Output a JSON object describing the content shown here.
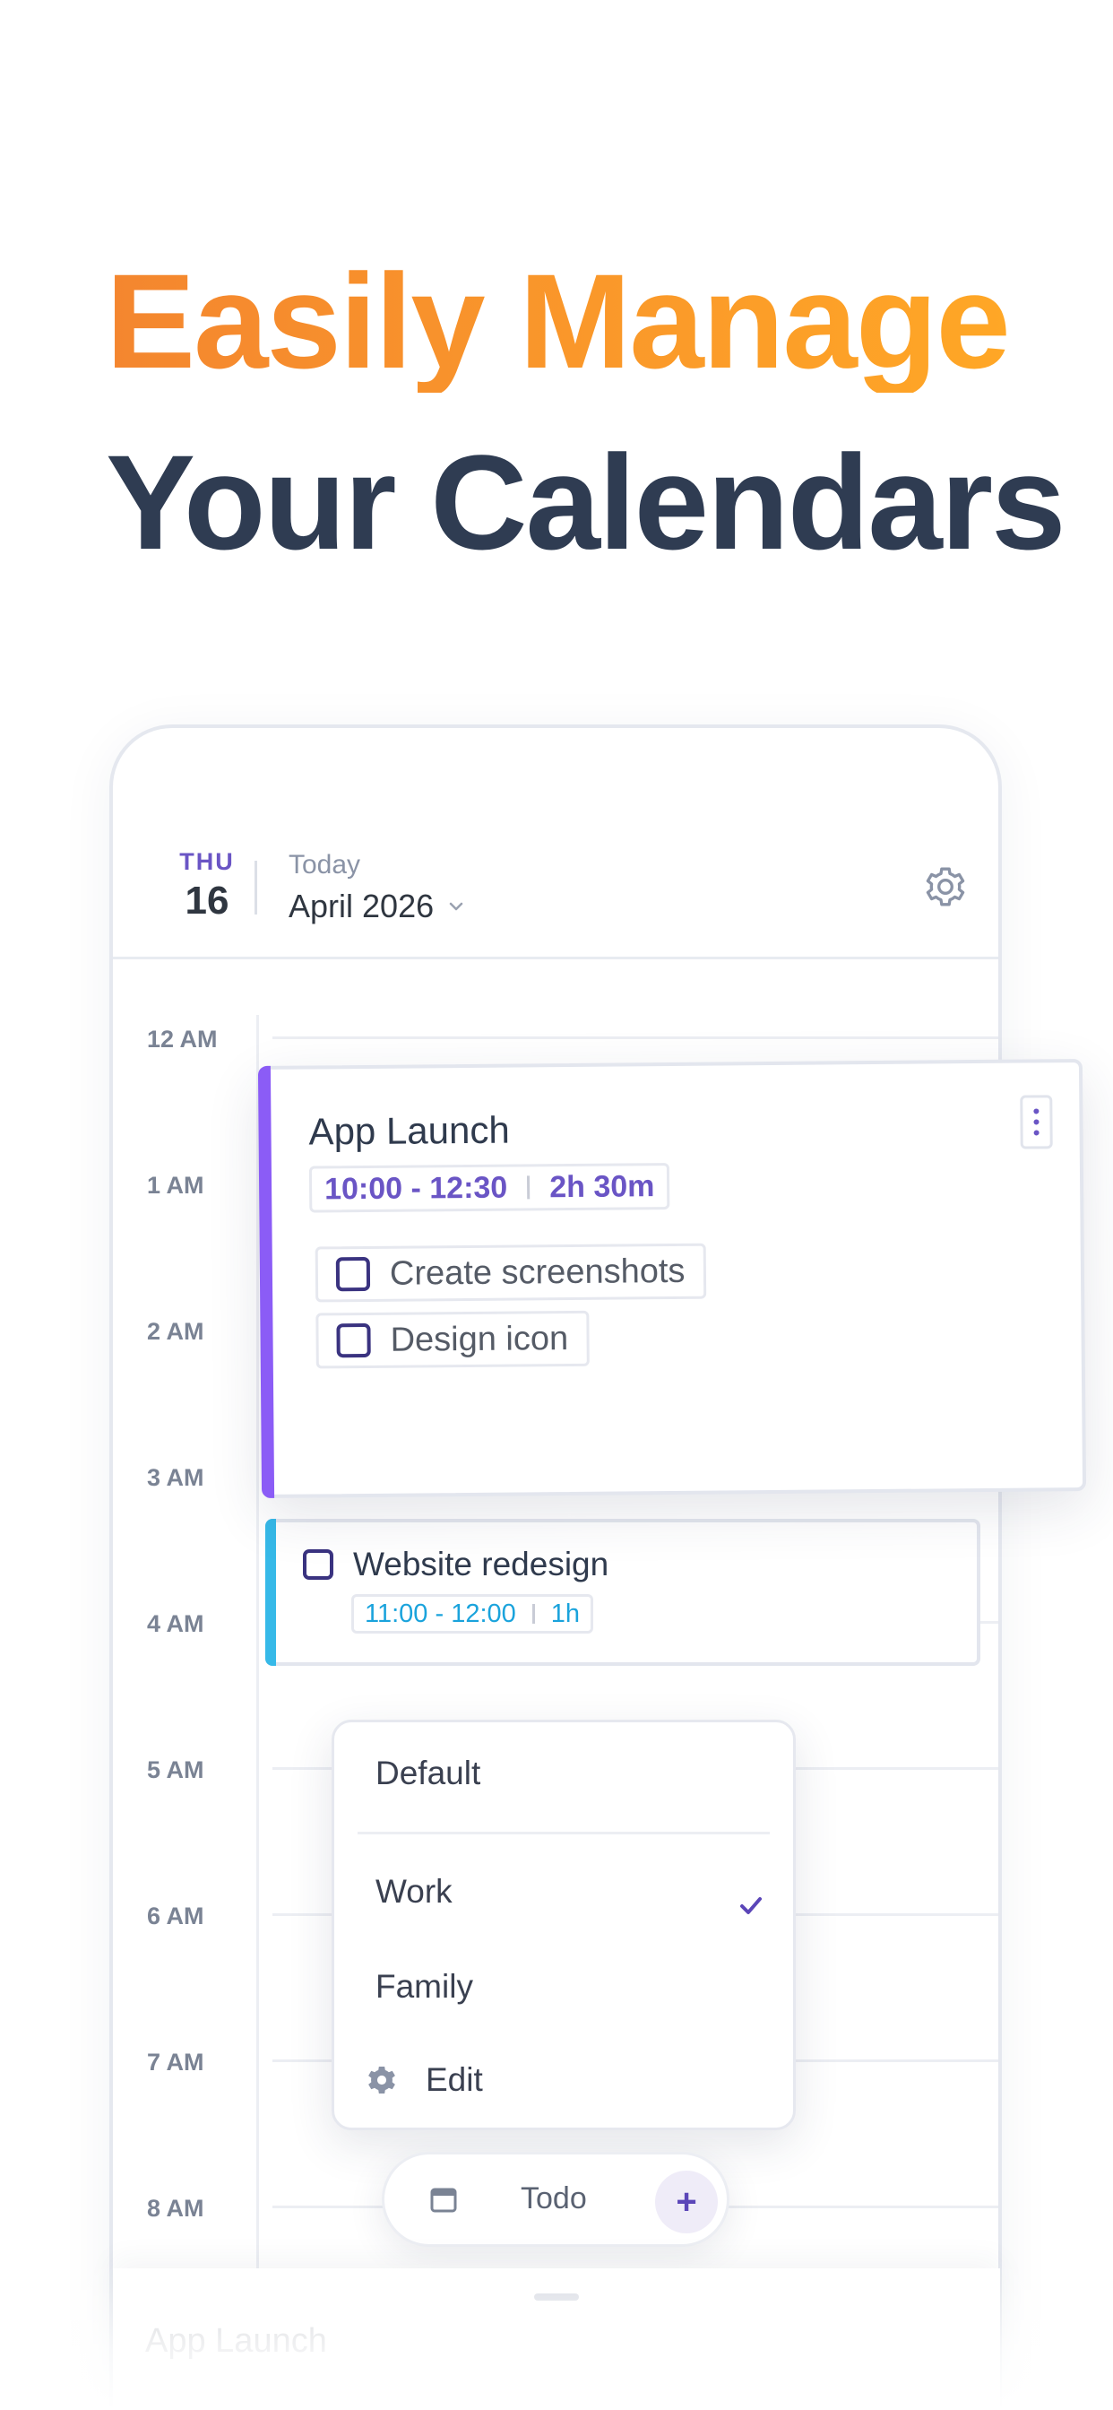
{
  "headline": {
    "line1": "Easily Manage",
    "line2": "Your Calendars"
  },
  "colors": {
    "accent_orange": "#f4862f",
    "headline_dark": "#2f3c52",
    "accent_purple": "#8b5cf6",
    "accent_blue": "#36b9e8",
    "check_dark": "#3a3380"
  },
  "calendar": {
    "day_abbr": "THU",
    "day_num": "16",
    "today_label": "Today",
    "month_label": "April 2026",
    "settings_icon": "gear-icon",
    "hours": [
      "12 AM",
      "1 AM",
      "2 AM",
      "3 AM",
      "4 AM",
      "5 AM",
      "6 AM",
      "7 AM",
      "8 AM"
    ]
  },
  "event_launch": {
    "title": "App Launch",
    "time_range": "10:00 - 12:30",
    "duration": "2h 30m",
    "tasks": [
      "Create screenshots",
      "Design icon"
    ]
  },
  "event_website": {
    "title": "Website redesign",
    "time_range": "11:00 - 12:00",
    "duration": "1h"
  },
  "calendar_menu": {
    "default_label": "Default",
    "work_label": "Work",
    "family_label": "Family",
    "edit_label": "Edit",
    "selected": "Work"
  },
  "bottom_bar": {
    "todo_label": "Todo",
    "add_label": "+"
  },
  "sheet": {
    "title": "App Launch"
  }
}
